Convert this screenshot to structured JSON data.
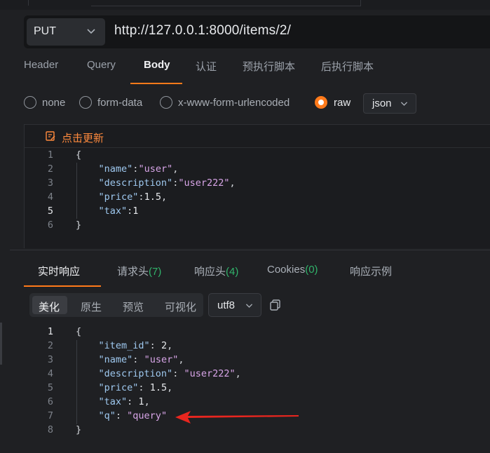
{
  "request": {
    "method": "PUT",
    "url": "http://127.0.0.1:8000/items/2/"
  },
  "request_tabs": [
    "Header",
    "Query",
    "Body",
    "认证",
    "预执行脚本",
    "后执行脚本"
  ],
  "active_request_tab": "Body",
  "body_types": [
    "none",
    "form-data",
    "x-www-form-urlencoded",
    "raw"
  ],
  "selected_body_type": "raw",
  "body_format": "json",
  "editor": {
    "toolbar_label": "点击更新",
    "lines": [
      {
        "num": "1",
        "tokens": [
          {
            "t": "{",
            "c": "p"
          }
        ]
      },
      {
        "num": "2",
        "tokens": [
          {
            "t": "    ",
            "c": "p"
          },
          {
            "t": "\"name\"",
            "c": "k"
          },
          {
            "t": ":",
            "c": "p"
          },
          {
            "t": "\"user\"",
            "c": "s"
          },
          {
            "t": ",",
            "c": "p"
          }
        ]
      },
      {
        "num": "3",
        "tokens": [
          {
            "t": "    ",
            "c": "p"
          },
          {
            "t": "\"description\"",
            "c": "k"
          },
          {
            "t": ":",
            "c": "p"
          },
          {
            "t": "\"user222\"",
            "c": "s"
          },
          {
            "t": ",",
            "c": "p"
          }
        ]
      },
      {
        "num": "4",
        "tokens": [
          {
            "t": "    ",
            "c": "p"
          },
          {
            "t": "\"price\"",
            "c": "k"
          },
          {
            "t": ":",
            "c": "p"
          },
          {
            "t": "1.5",
            "c": "n"
          },
          {
            "t": ",",
            "c": "p"
          }
        ]
      },
      {
        "num": "5",
        "tokens": [
          {
            "t": "    ",
            "c": "p"
          },
          {
            "t": "\"tax\"",
            "c": "k"
          },
          {
            "t": ":",
            "c": "p"
          },
          {
            "t": "1",
            "c": "n"
          }
        ]
      },
      {
        "num": "6",
        "tokens": [
          {
            "t": "}",
            "c": "p"
          }
        ]
      }
    ]
  },
  "response_tabs": [
    {
      "label": "实时响应",
      "count": ""
    },
    {
      "label": "请求头",
      "count": "(7)"
    },
    {
      "label": "响应头",
      "count": "(4)"
    },
    {
      "label": "Cookies",
      "count": "(0)"
    },
    {
      "label": "响应示例",
      "count": ""
    }
  ],
  "view_modes": [
    "美化",
    "原生",
    "预览",
    "可视化"
  ],
  "active_view_mode": "美化",
  "encoding": "utf8",
  "response_body": {
    "lines": [
      {
        "num": "1",
        "tokens": [
          {
            "t": "{",
            "c": "p"
          }
        ]
      },
      {
        "num": "2",
        "tokens": [
          {
            "t": "    ",
            "c": "p"
          },
          {
            "t": "\"item_id\"",
            "c": "k"
          },
          {
            "t": ": ",
            "c": "p"
          },
          {
            "t": "2",
            "c": "n"
          },
          {
            "t": ",",
            "c": "p"
          }
        ]
      },
      {
        "num": "3",
        "tokens": [
          {
            "t": "    ",
            "c": "p"
          },
          {
            "t": "\"name\"",
            "c": "k"
          },
          {
            "t": ": ",
            "c": "p"
          },
          {
            "t": "\"user\"",
            "c": "s"
          },
          {
            "t": ",",
            "c": "p"
          }
        ]
      },
      {
        "num": "4",
        "tokens": [
          {
            "t": "    ",
            "c": "p"
          },
          {
            "t": "\"description\"",
            "c": "k"
          },
          {
            "t": ": ",
            "c": "p"
          },
          {
            "t": "\"user222\"",
            "c": "s"
          },
          {
            "t": ",",
            "c": "p"
          }
        ]
      },
      {
        "num": "5",
        "tokens": [
          {
            "t": "    ",
            "c": "p"
          },
          {
            "t": "\"price\"",
            "c": "k"
          },
          {
            "t": ": ",
            "c": "p"
          },
          {
            "t": "1.5",
            "c": "n"
          },
          {
            "t": ",",
            "c": "p"
          }
        ]
      },
      {
        "num": "6",
        "tokens": [
          {
            "t": "    ",
            "c": "p"
          },
          {
            "t": "\"tax\"",
            "c": "k"
          },
          {
            "t": ": ",
            "c": "p"
          },
          {
            "t": "1",
            "c": "n"
          },
          {
            "t": ",",
            "c": "p"
          }
        ]
      },
      {
        "num": "7",
        "tokens": [
          {
            "t": "    ",
            "c": "p"
          },
          {
            "t": "\"q\"",
            "c": "k"
          },
          {
            "t": ": ",
            "c": "p"
          },
          {
            "t": "\"query\"",
            "c": "s"
          }
        ]
      },
      {
        "num": "8",
        "tokens": [
          {
            "t": "}",
            "c": "p"
          }
        ]
      }
    ]
  },
  "colors": {
    "accent": "#ff7a1a",
    "count_green": "#31b36b",
    "annotation_arrow": "#e8261f"
  }
}
